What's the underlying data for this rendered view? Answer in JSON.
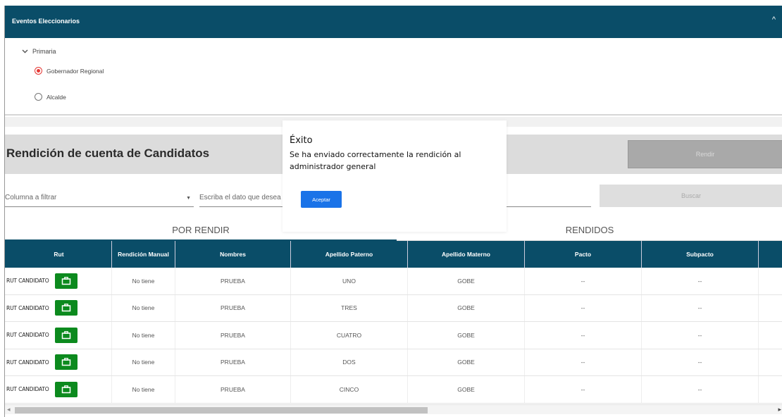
{
  "events": {
    "title": "Eventos Eleccionarios",
    "collapse_icon": "^",
    "tree_node": "Primaria",
    "options": [
      {
        "label": "Gobernador Regional",
        "checked": true
      },
      {
        "label": "Alcalde",
        "checked": false
      }
    ]
  },
  "page": {
    "title": "Rendición de cuenta de Candidatos",
    "rendir_label": "Rendir"
  },
  "filter": {
    "column_placeholder": "Columna a filtrar",
    "input_placeholder": "Escriba el dato que desea",
    "search_label": "Buscar"
  },
  "tabs": [
    {
      "label": "POR RENDIR",
      "active": true
    },
    {
      "label": "RENDIDOS",
      "active": false
    }
  ],
  "table": {
    "headers": {
      "rut": "Rut",
      "manual": "Rendición Manual",
      "nombres": "Nombres",
      "apaterno": "Apellido Paterno",
      "amaterno": "Apellido Materno",
      "pacto": "Pacto",
      "subpacto": "Subpacto"
    },
    "rows": [
      {
        "rut": "RUT CANDIDATO",
        "manual": "No tiene",
        "nombres": "PRUEBA",
        "apaterno": "UNO",
        "amaterno": "GOBE",
        "pacto": "--",
        "subpacto": "--"
      },
      {
        "rut": "RUT CANDIDATO",
        "manual": "No tiene",
        "nombres": "PRUEBA",
        "apaterno": "TRES",
        "amaterno": "GOBE",
        "pacto": "--",
        "subpacto": "--"
      },
      {
        "rut": "RUT CANDIDATO",
        "manual": "No tiene",
        "nombres": "PRUEBA",
        "apaterno": "CUATRO",
        "amaterno": "GOBE",
        "pacto": "--",
        "subpacto": "--"
      },
      {
        "rut": "RUT CANDIDATO",
        "manual": "No tiene",
        "nombres": "PRUEBA",
        "apaterno": "DOS",
        "amaterno": "GOBE",
        "pacto": "--",
        "subpacto": "--"
      },
      {
        "rut": "RUT CANDIDATO",
        "manual": "No tiene",
        "nombres": "PRUEBA",
        "apaterno": "CINCO",
        "amaterno": "GOBE",
        "pacto": "--",
        "subpacto": "--"
      }
    ]
  },
  "modal": {
    "title": "Éxito",
    "message": "Se ha enviado correctamente la rendición al administrador general",
    "accept_label": "Aceptar"
  },
  "colors": {
    "header": "#0a4d68",
    "action_green": "#0c8a1e",
    "accept_blue": "#1a73e8",
    "radio_red": "#e53935"
  }
}
